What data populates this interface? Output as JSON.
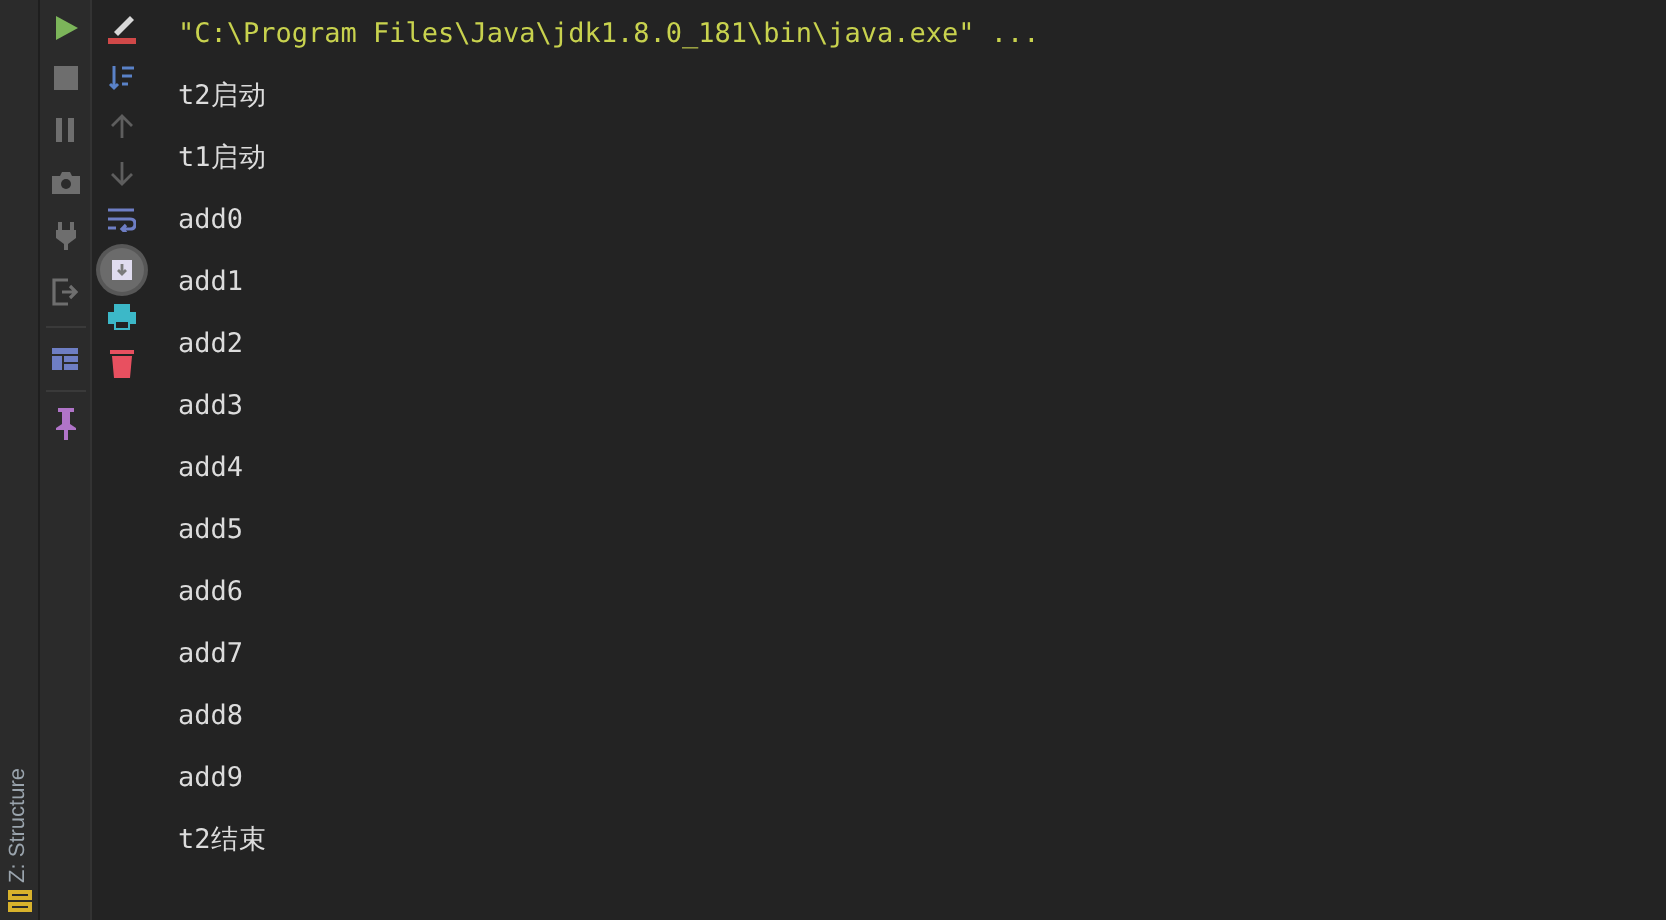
{
  "side_stripe": {
    "tool_window": "Z: Structure"
  },
  "console_toolbar": {
    "scroll_to_end_on": true
  },
  "console": {
    "lines": [
      {
        "kind": "command",
        "text": "\"C:\\Program Files\\Java\\jdk1.8.0_181\\bin\\java.exe\" ..."
      },
      {
        "kind": "output",
        "text": "t2启动"
      },
      {
        "kind": "output",
        "text": "t1启动"
      },
      {
        "kind": "output",
        "text": "add0"
      },
      {
        "kind": "output",
        "text": "add1"
      },
      {
        "kind": "output",
        "text": "add2"
      },
      {
        "kind": "output",
        "text": "add3"
      },
      {
        "kind": "output",
        "text": "add4"
      },
      {
        "kind": "output",
        "text": "add5"
      },
      {
        "kind": "output",
        "text": "add6"
      },
      {
        "kind": "output",
        "text": "add7"
      },
      {
        "kind": "output",
        "text": "add8"
      },
      {
        "kind": "output",
        "text": "add9"
      },
      {
        "kind": "output",
        "text": "t2结束"
      }
    ]
  }
}
